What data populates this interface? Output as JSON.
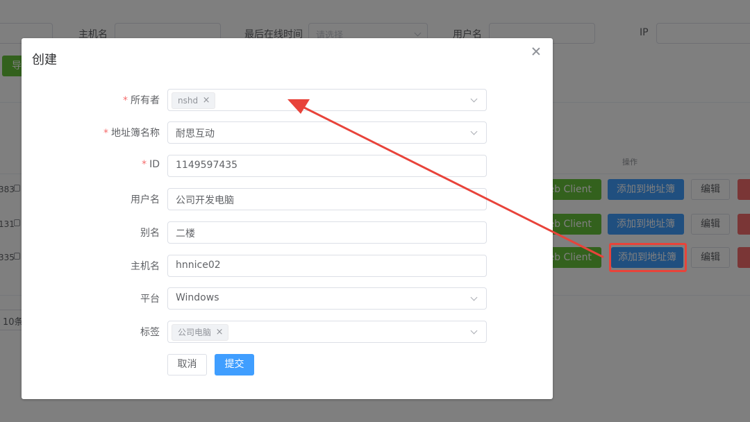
{
  "background": {
    "filters": {
      "hostname_label": "主机名",
      "last_online_label": "最后在线时间",
      "last_online_placeholder": "请选择",
      "username_label": "用户名",
      "ip_label": "IP"
    },
    "toolbar": {
      "export_label_partial": "导"
    },
    "table": {
      "operation_header": "操作",
      "rows": [
        {
          "id_partial": "383",
          "web_client": "eb Client",
          "add_book": "添加到地址簿",
          "edit": "编辑"
        },
        {
          "id_partial": "131",
          "web_client": "eb Client",
          "add_book": "添加到地址簿",
          "edit": "编辑"
        },
        {
          "id_partial": "335",
          "web_client": "eb Client",
          "add_book": "添加到地址簿",
          "edit": "编辑"
        }
      ]
    },
    "pagination": {
      "page_size_partial": "10条"
    }
  },
  "dialog": {
    "title": "创建",
    "required_mark": "*",
    "fields": {
      "owner": {
        "label": "所有者",
        "tag": "nshd"
      },
      "address_book_name": {
        "label": "地址簿名称",
        "value": "耐思互动"
      },
      "id": {
        "label": "ID",
        "value": "1149597435"
      },
      "username": {
        "label": "用户名",
        "value": "公司开发电脑"
      },
      "alias": {
        "label": "别名",
        "value": "二楼"
      },
      "hostname": {
        "label": "主机名",
        "value": "hnnice02"
      },
      "platform": {
        "label": "平台",
        "value": "Windows"
      },
      "tags": {
        "label": "标签",
        "tag": "公司电脑"
      }
    },
    "tag_remove_glyph": "×",
    "cancel_label": "取消",
    "submit_label": "提交"
  },
  "colors": {
    "primary": "#409eff",
    "success": "#67c23a",
    "danger": "#f56c6c",
    "annotation": "#e8433a"
  }
}
